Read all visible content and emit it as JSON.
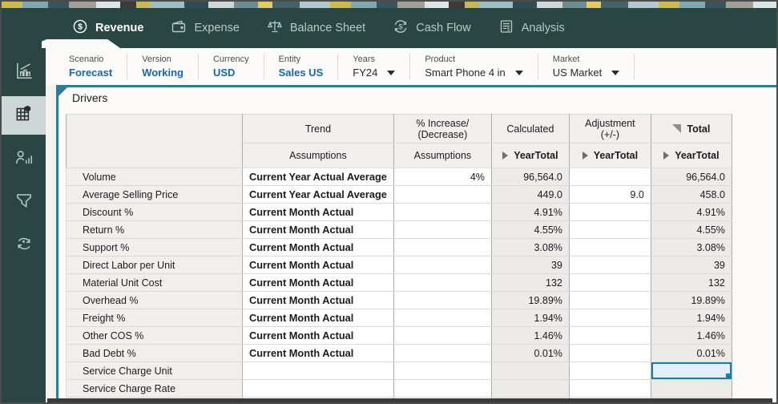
{
  "appbar": {
    "tabs": [
      {
        "label": "Revenue",
        "icon": "dollar-circle-icon",
        "active": true
      },
      {
        "label": "Expense",
        "icon": "wallet-icon",
        "active": false
      },
      {
        "label": "Balance Sheet",
        "icon": "scales-icon",
        "active": false
      },
      {
        "label": "Cash Flow",
        "icon": "dollar-cycle-icon",
        "active": false
      },
      {
        "label": "Analysis",
        "icon": "report-icon",
        "active": false
      }
    ]
  },
  "sidebar": {
    "icons": [
      "bar-chart",
      "grid-cube",
      "member-analytics",
      "funnel",
      "process-loop"
    ],
    "active_index": 1
  },
  "pov": {
    "items": [
      {
        "label": "Scenario",
        "value": "Forecast",
        "style": "link",
        "dropdown": false
      },
      {
        "label": "Version",
        "value": "Working",
        "style": "link",
        "dropdown": false
      },
      {
        "label": "Currency",
        "value": "USD",
        "style": "link",
        "dropdown": false
      },
      {
        "label": "Entity",
        "value": "Sales US",
        "style": "link",
        "dropdown": false
      },
      {
        "label": "Years",
        "value": "FY24",
        "style": "plain",
        "dropdown": true
      },
      {
        "label": "Product",
        "value": "Smart Phone 4 in",
        "style": "plain",
        "dropdown": true
      },
      {
        "label": "Market",
        "value": "US Market",
        "style": "plain",
        "dropdown": true
      }
    ]
  },
  "panel": {
    "title": "Drivers"
  },
  "table": {
    "h1": {
      "trend": "Trend",
      "pct_line1": "% Increase/",
      "pct_line2": "(Decrease)",
      "calculated": "Calculated",
      "adj_line1": "Adjustment",
      "adj_line2": "(+/-)",
      "total": "Total"
    },
    "h2": {
      "trend": "Assumptions",
      "pct": "Assumptions",
      "calculated": "YearTotal",
      "adjustment": "YearTotal",
      "total": "YearTotal"
    },
    "rows": [
      {
        "name": "Volume",
        "trend": "Current Year Actual Average",
        "pct": "4%",
        "calc": "96,564.0",
        "adj": "",
        "total": "96,564.0"
      },
      {
        "name": "Average Selling Price",
        "trend": "Current Year Actual Average",
        "pct": "",
        "calc": "449.0",
        "adj": "9.0",
        "total": "458.0"
      },
      {
        "name": "Discount %",
        "trend": "Current Month Actual",
        "pct": "",
        "calc": "4.91%",
        "adj": "",
        "total": "4.91%"
      },
      {
        "name": "Return %",
        "trend": "Current Month Actual",
        "pct": "",
        "calc": "4.55%",
        "adj": "",
        "total": "4.55%"
      },
      {
        "name": "Support %",
        "trend": "Current Month Actual",
        "pct": "",
        "calc": "3.08%",
        "adj": "",
        "total": "3.08%"
      },
      {
        "name": "Direct Labor per Unit",
        "trend": "Current Month Actual",
        "pct": "",
        "calc": "39",
        "adj": "",
        "total": "39"
      },
      {
        "name": "Material Unit Cost",
        "trend": "Current Month Actual",
        "pct": "",
        "calc": "132",
        "adj": "",
        "total": "132"
      },
      {
        "name": "Overhead %",
        "trend": "Current Month Actual",
        "pct": "",
        "calc": "19.89%",
        "adj": "",
        "total": "19.89%"
      },
      {
        "name": "Freight %",
        "trend": "Current Month Actual",
        "pct": "",
        "calc": "1.94%",
        "adj": "",
        "total": "1.94%"
      },
      {
        "name": "Other COS %",
        "trend": "Current Month Actual",
        "pct": "",
        "calc": "1.46%",
        "adj": "",
        "total": "1.46%"
      },
      {
        "name": "Bad Debt %",
        "trend": "Current Month Actual",
        "pct": "",
        "calc": "0.01%",
        "adj": "",
        "total": "0.01%"
      },
      {
        "name": "Service Charge Unit",
        "trend": "",
        "pct": "",
        "calc": "",
        "adj": "",
        "total": "",
        "selected_total": true
      },
      {
        "name": "Service Charge Rate",
        "trend": "",
        "pct": "",
        "calc": "",
        "adj": "",
        "total": ""
      }
    ],
    "selection": {
      "row": "Service Charge Unit",
      "column": "Total"
    }
  },
  "colors": {
    "header_teal": "#2a4642",
    "accent_teal": "#2c7d92",
    "link_blue": "#1d66a5",
    "selection_border": "#1f7da5",
    "selection_fill": "#e2eff6"
  }
}
